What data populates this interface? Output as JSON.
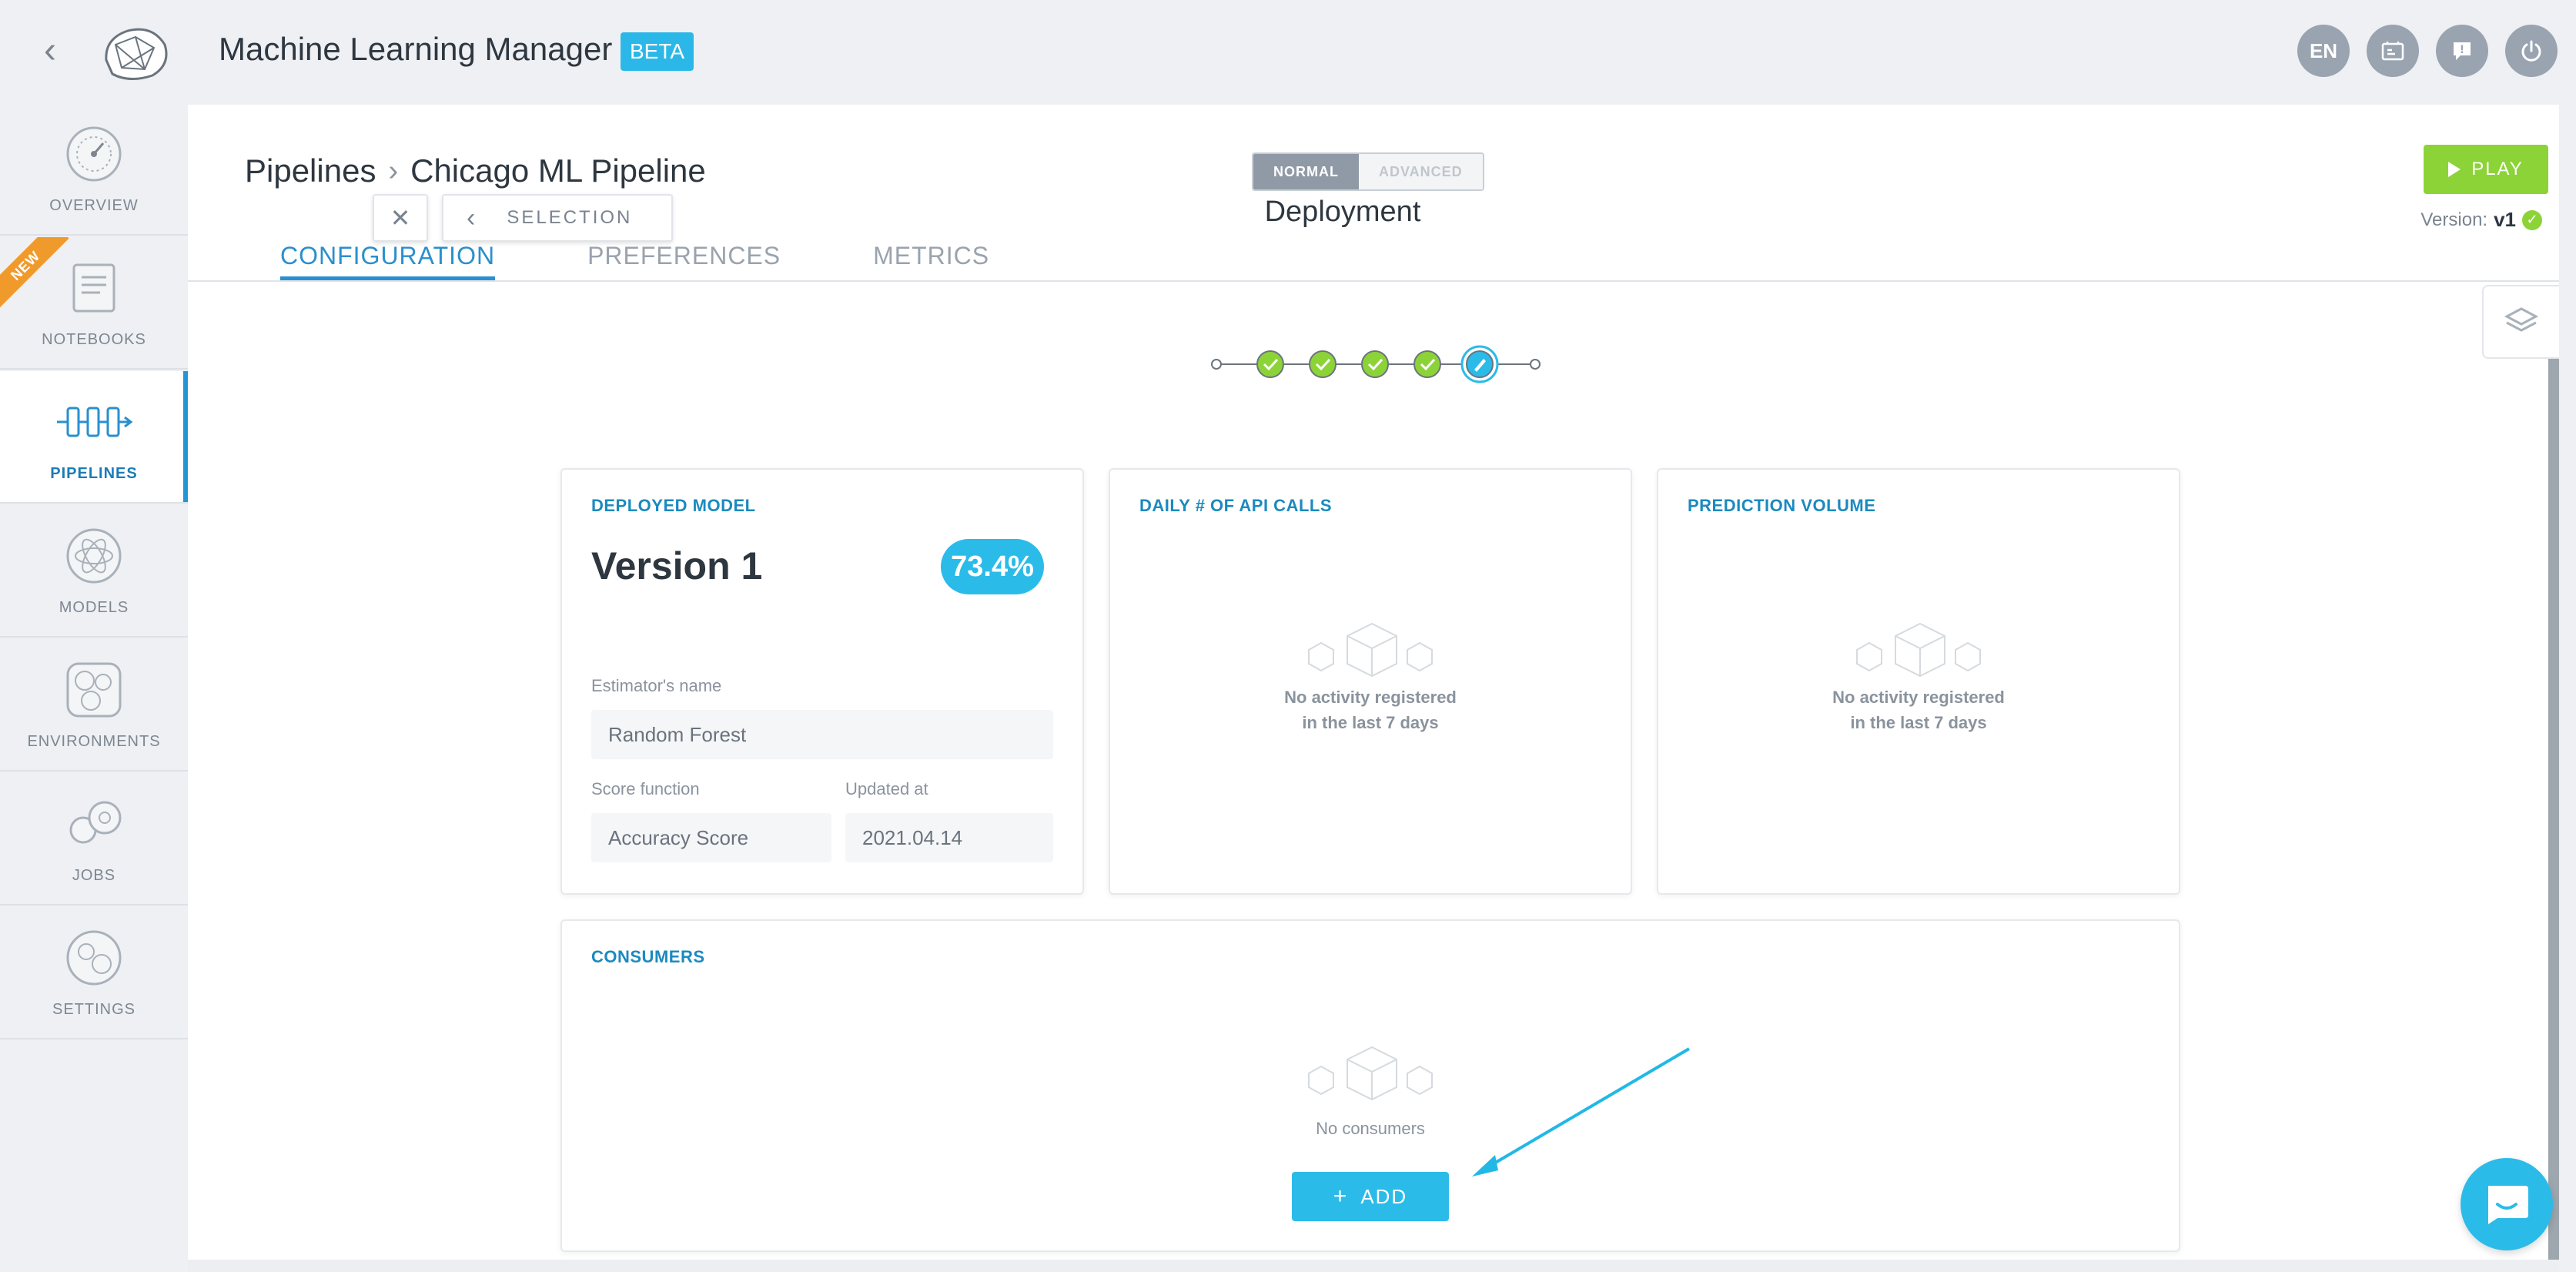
{
  "app": {
    "title": "Machine Learning Manager",
    "badge": "BETA"
  },
  "topbar": {
    "lang": "EN"
  },
  "sidebar": {
    "new_label": "NEW",
    "items": [
      {
        "label": "OVERVIEW"
      },
      {
        "label": "NOTEBOOKS"
      },
      {
        "label": "PIPELINES"
      },
      {
        "label": "MODELS"
      },
      {
        "label": "ENVIRONMENTS"
      },
      {
        "label": "JOBS"
      },
      {
        "label": "SETTINGS"
      }
    ]
  },
  "header": {
    "breadcrumb_root": "Pipelines",
    "breadcrumb_current": "Chicago ML Pipeline",
    "mode_normal": "NORMAL",
    "mode_advanced": "ADVANCED",
    "play_label": "PLAY",
    "version_label": "Version:",
    "version_value": "v1",
    "tabs": [
      {
        "label": "CONFIGURATION"
      },
      {
        "label": "PREFERENCES"
      },
      {
        "label": "METRICS"
      }
    ]
  },
  "wizard": {
    "selection_label": "SELECTION",
    "step_title": "Deployment",
    "completed_steps": 4
  },
  "deployed_model": {
    "title": "DEPLOYED MODEL",
    "version": "Version 1",
    "score": "73.4%",
    "estimator_label": "Estimator's name",
    "estimator_value": "Random Forest",
    "score_fn_label": "Score function",
    "score_fn_value": "Accuracy Score",
    "updated_label": "Updated at",
    "updated_value": "2021.04.14"
  },
  "api_calls": {
    "title": "DAILY # OF API CALLS",
    "empty_line1": "No activity registered",
    "empty_line2": "in the last 7 days"
  },
  "prediction_volume": {
    "title": "PREDICTION VOLUME",
    "empty_line1": "No activity registered",
    "empty_line2": "in the last 7 days"
  },
  "consumers": {
    "title": "CONSUMERS",
    "empty": "No consumers",
    "add_label": "ADD"
  },
  "colors": {
    "accent": "#2bbbe9",
    "play_green": "#8cd337",
    "tab_active": "#2a8fce",
    "arrow": "#22b8e6"
  }
}
